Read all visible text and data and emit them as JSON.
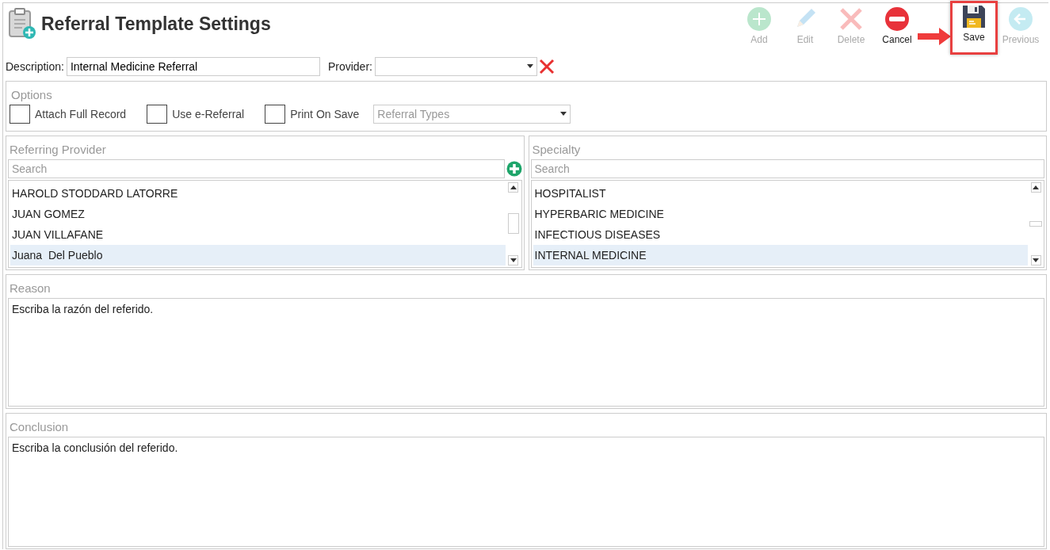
{
  "header": {
    "title": "Referral Template Settings"
  },
  "toolbar": [
    {
      "label": "Add",
      "kind": "add",
      "disabled": true,
      "highlighted": false
    },
    {
      "label": "Edit",
      "kind": "edit",
      "disabled": true,
      "highlighted": false
    },
    {
      "label": "Delete",
      "kind": "delete",
      "disabled": true,
      "highlighted": false
    },
    {
      "label": "Cancel",
      "kind": "cancel",
      "disabled": false,
      "highlighted": false
    },
    {
      "label": "Save",
      "kind": "save",
      "disabled": false,
      "highlighted": true
    },
    {
      "label": "Previous",
      "kind": "previous",
      "disabled": true,
      "highlighted": false
    }
  ],
  "description": {
    "label": "Description:",
    "value": "Internal Medicine Referral"
  },
  "provider": {
    "label": "Provider:"
  },
  "options": {
    "title": "Options",
    "checkboxes": [
      {
        "label": "Attach Full Record",
        "checked": false
      },
      {
        "label": "Use e-Referral",
        "checked": false
      },
      {
        "label": "Print On Save",
        "checked": false
      }
    ],
    "referral_types": {
      "placeholder": "Referral Types"
    }
  },
  "referring_provider": {
    "title": "Referring Provider",
    "search": {
      "placeholder": "Search"
    },
    "items": [
      {
        "text": "HAROLD STODDARD LATORRE",
        "selected": false
      },
      {
        "text": "JUAN GOMEZ",
        "selected": false
      },
      {
        "text": "JUAN VILLAFANE",
        "selected": false
      },
      {
        "text": "Juana  Del Pueblo",
        "selected": true
      }
    ]
  },
  "specialty": {
    "title": "Specialty",
    "search": {
      "placeholder": "Search"
    },
    "items": [
      {
        "text": "HOSPITALIST",
        "selected": false
      },
      {
        "text": "HYPERBARIC MEDICINE",
        "selected": false
      },
      {
        "text": "INFECTIOUS DISEASES",
        "selected": false
      },
      {
        "text": "INTERNAL MEDICINE",
        "selected": true
      }
    ]
  },
  "reason": {
    "title": "Reason",
    "value": "Escriba la razón del referido."
  },
  "conclusion": {
    "title": "Conclusion",
    "value": "Escriba la conclusión del referido."
  }
}
